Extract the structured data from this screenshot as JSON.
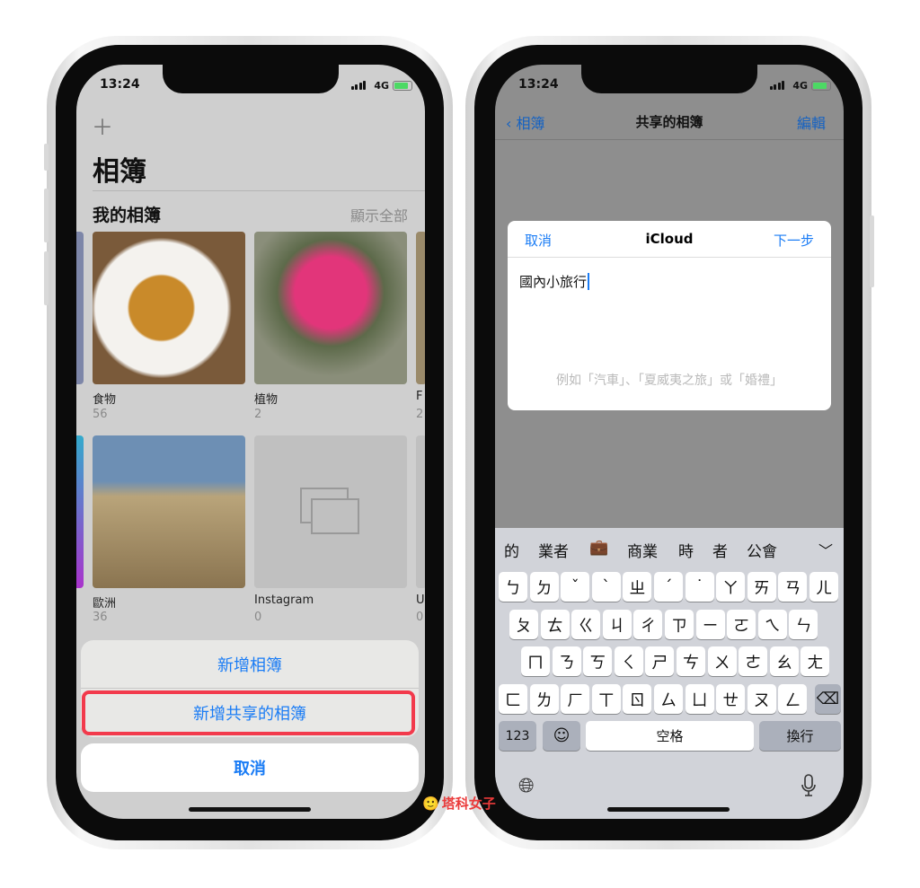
{
  "status": {
    "time": "13:24",
    "network": "4G"
  },
  "left": {
    "add_icon": "plus-icon",
    "title": "相簿",
    "section": "我的相簿",
    "show_all": "顯示全部",
    "albums": [
      {
        "name": "食物",
        "count": "56"
      },
      {
        "name": "植物",
        "count": "2"
      },
      {
        "name": "F",
        "count": "2"
      },
      {
        "name": "歐洲",
        "count": "36"
      },
      {
        "name": "Instagram",
        "count": "0"
      },
      {
        "name": "U",
        "count": "0"
      }
    ],
    "sheet": {
      "new_album": "新增相簿",
      "new_shared_album": "新增共享的相簿",
      "cancel": "取消"
    },
    "highlight_color": "#f23a4c"
  },
  "right": {
    "nav": {
      "back": "相簿",
      "title": "共享的相簿",
      "edit": "編輯"
    },
    "dialog": {
      "cancel": "取消",
      "title": "iCloud",
      "next": "下一步",
      "value": "國內小旅行",
      "placeholder": "例如「汽車」、「夏威夷之旅」或「婚禮」"
    },
    "keyboard": {
      "suggestions": [
        "的",
        "業者",
        "💼",
        "商業",
        "時",
        "者",
        "公會"
      ],
      "rows": [
        [
          "ㄅ",
          "ㄉ",
          "ˇ",
          "ˋ",
          "ㄓ",
          "ˊ",
          "˙",
          "ㄚ",
          "ㄞ",
          "ㄢ",
          "ㄦ"
        ],
        [
          "ㄆ",
          "ㄊ",
          "ㄍ",
          "ㄐ",
          "ㄔ",
          "ㄗ",
          "ㄧ",
          "ㄛ",
          "ㄟ",
          "ㄣ"
        ],
        [
          "ㄇ",
          "ㄋ",
          "ㄎ",
          "ㄑ",
          "ㄕ",
          "ㄘ",
          "ㄨ",
          "ㄜ",
          "ㄠ",
          "ㄤ"
        ],
        [
          "ㄈ",
          "ㄌ",
          "ㄏ",
          "ㄒ",
          "ㄖ",
          "ㄙ",
          "ㄩ",
          "ㄝ",
          "ㄡ",
          "ㄥ"
        ]
      ],
      "numbers": "123",
      "space": "空格",
      "return": "換行"
    }
  },
  "watermark": "塔科女子",
  "accent": "#1a7cf5"
}
